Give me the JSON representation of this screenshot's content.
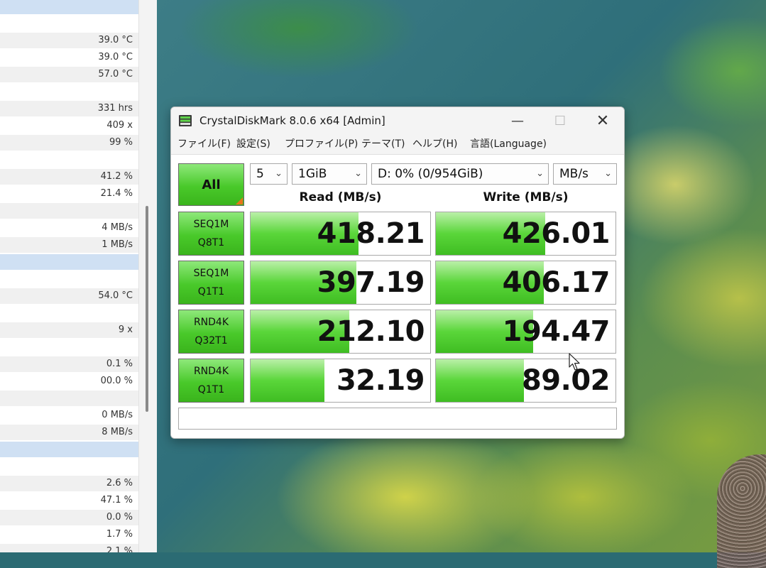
{
  "left_panel": {
    "rows": [
      {
        "text": "",
        "style": "hl"
      },
      {
        "text": "",
        "style": "plain"
      },
      {
        "text": "39.0 °C",
        "style": "shade"
      },
      {
        "text": "39.0 °C",
        "style": "plain"
      },
      {
        "text": "57.0 °C",
        "style": "shade"
      },
      {
        "text": "",
        "style": "plain"
      },
      {
        "text": "331 hrs",
        "style": "shade"
      },
      {
        "text": "409 x",
        "style": "plain"
      },
      {
        "text": "99 %",
        "style": "shade"
      },
      {
        "text": "",
        "style": "plain"
      },
      {
        "text": "41.2 %",
        "style": "shade"
      },
      {
        "text": "21.4 %",
        "style": "plain"
      },
      {
        "text": "",
        "style": "shade"
      },
      {
        "text": "4 MB/s",
        "style": "plain"
      },
      {
        "text": "1 MB/s",
        "style": "shade"
      },
      {
        "text": "",
        "style": "hl"
      },
      {
        "text": "",
        "style": "plain"
      },
      {
        "text": "54.0 °C",
        "style": "shade"
      },
      {
        "text": "",
        "style": "plain"
      },
      {
        "text": "9 x",
        "style": "shade"
      },
      {
        "text": "",
        "style": "plain"
      },
      {
        "text": "0.1 %",
        "style": "shade"
      },
      {
        "text": "00.0 %",
        "style": "plain"
      },
      {
        "text": "",
        "style": "shade"
      },
      {
        "text": "0 MB/s",
        "style": "plain"
      },
      {
        "text": "8 MB/s",
        "style": "shade"
      },
      {
        "text": "",
        "style": "hl"
      },
      {
        "text": "",
        "style": "plain"
      },
      {
        "text": "2.6 %",
        "style": "shade"
      },
      {
        "text": "47.1 %",
        "style": "plain"
      },
      {
        "text": "0.0 %",
        "style": "shade"
      },
      {
        "text": "1.7 %",
        "style": "plain"
      },
      {
        "text": "2.1 %",
        "style": "shade"
      }
    ]
  },
  "window": {
    "title": "CrystalDiskMark 8.0.6 x64 [Admin]",
    "controls": {
      "minimize": "—",
      "maximize": "☐",
      "close": "✕"
    }
  },
  "menu": {
    "items": [
      "ファイル(F)",
      "設定(S)",
      "プロファイル(P)",
      "テーマ(T)",
      "ヘルプ(H)",
      "言語(Language)"
    ]
  },
  "toolbar": {
    "all_label": "All",
    "count": "5",
    "size": "1GiB",
    "drive": "D: 0% (0/954GiB)",
    "unit": "MB/s"
  },
  "headers": {
    "read": "Read (MB/s)",
    "write": "Write (MB/s)"
  },
  "tests": [
    {
      "line1": "SEQ1M",
      "line2": "Q8T1",
      "read": "418.21",
      "write": "426.01",
      "read_fill": 0.6,
      "write_fill": 0.61
    },
    {
      "line1": "SEQ1M",
      "line2": "Q1T1",
      "read": "397.19",
      "write": "406.17",
      "read_fill": 0.59,
      "write_fill": 0.6
    },
    {
      "line1": "RND4K",
      "line2": "Q32T1",
      "read": "212.10",
      "write": "194.47",
      "read_fill": 0.55,
      "write_fill": 0.54
    },
    {
      "line1": "RND4K",
      "line2": "Q1T1",
      "read": "32.19",
      "write": "89.02",
      "read_fill": 0.41,
      "write_fill": 0.49
    }
  ],
  "comment": "",
  "colors": {
    "bar_green": "#49c92a",
    "accent_orange": "#e8741c"
  },
  "icons": {
    "app": "crystaldiskmark-icon",
    "cursor": "mouse-pointer-icon"
  }
}
